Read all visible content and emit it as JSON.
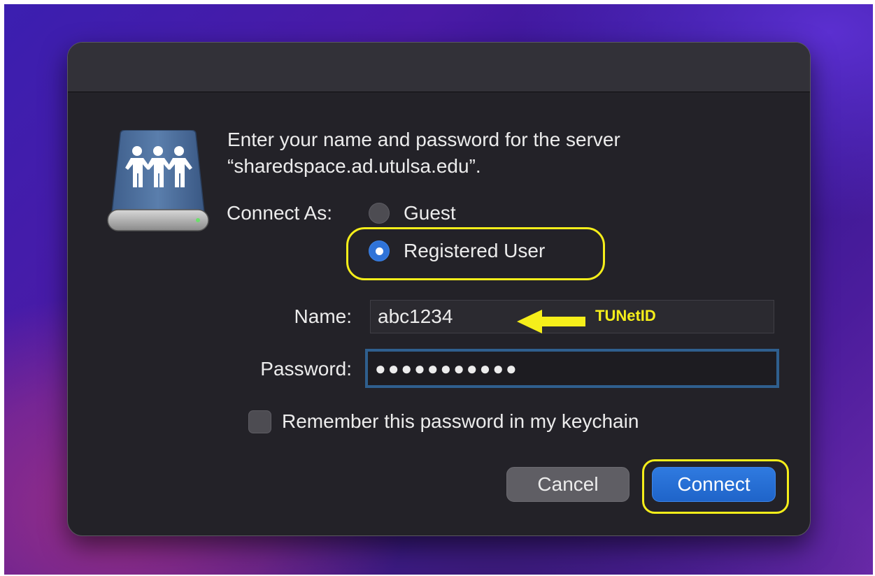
{
  "dialog": {
    "message_line1": "Enter your name and password for the server",
    "message_line2": "“sharedspace.ad.utulsa.edu”.",
    "connect_as_label": "Connect As:",
    "radio_options": [
      {
        "label": "Guest",
        "selected": false
      },
      {
        "label": "Registered User",
        "selected": true
      }
    ],
    "name_label": "Name:",
    "name_value": "abc1234",
    "password_label": "Password:",
    "password_mask": "●●●●●●●●●●●",
    "remember_label": "Remember this password in my keychain",
    "remember_checked": false,
    "cancel_label": "Cancel",
    "connect_label": "Connect"
  },
  "annotations": {
    "name_hint": "TUNetID",
    "highlight_color": "#f5ee1a"
  },
  "colors": {
    "accent": "#2f73d8",
    "dialog_bg": "#232228"
  },
  "icons": {
    "server": "shared-server-drive-icon"
  }
}
